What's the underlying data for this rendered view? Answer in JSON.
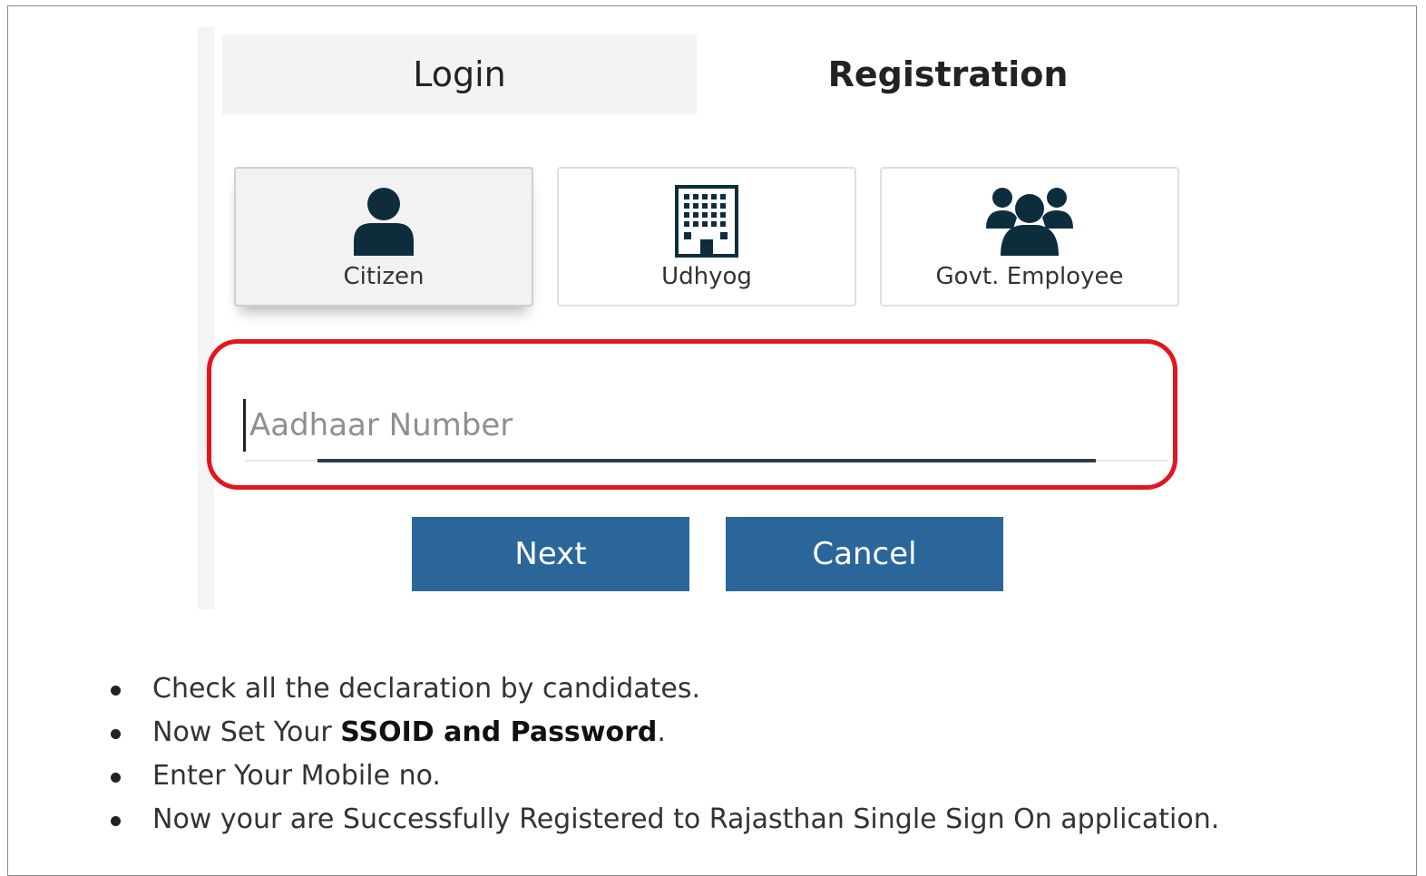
{
  "tabs": {
    "login": "Login",
    "registration": "Registration"
  },
  "user_types": [
    {
      "label": "Citizen",
      "icon": "user-icon",
      "selected": true
    },
    {
      "label": "Udhyog",
      "icon": "building-icon",
      "selected": false
    },
    {
      "label": "Govt. Employee",
      "icon": "users-group-icon",
      "selected": false
    }
  ],
  "aadhaar": {
    "placeholder": "Aadhaar Number",
    "value": ""
  },
  "buttons": {
    "next": "Next",
    "cancel": "Cancel"
  },
  "colors": {
    "button_bg": "#2a6699",
    "icon": "#0d2d3d",
    "highlight": "#e3161d"
  },
  "steps": {
    "item1": "Check all the declaration by candidates.",
    "item2_prefix": "Now Set Your ",
    "item2_bold": "SSOID and Password",
    "item2_suffix": ".",
    "item3": "Enter Your Mobile no.",
    "item4": "Now your are Successfully Registered to Rajasthan Single Sign On application."
  }
}
